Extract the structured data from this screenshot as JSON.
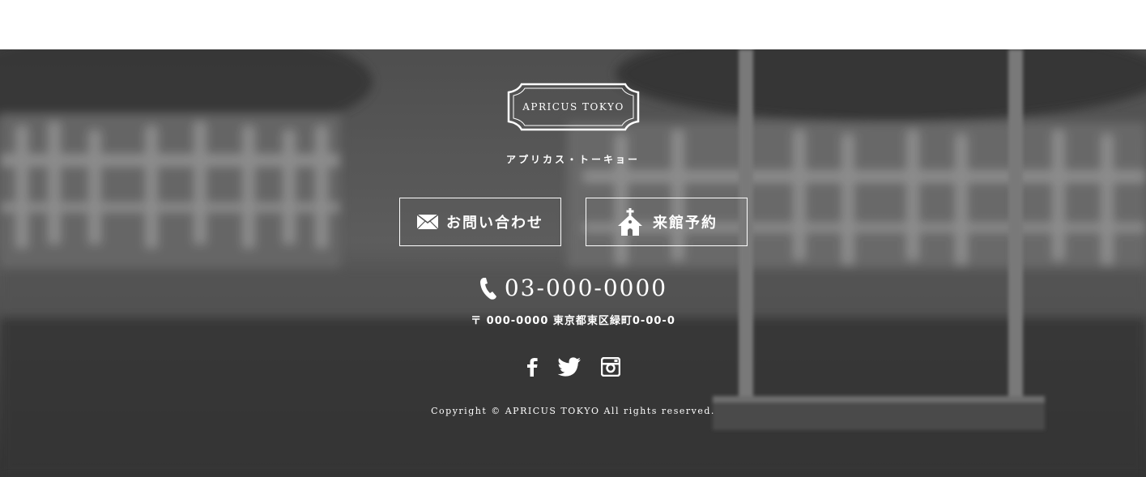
{
  "logo": {
    "text": "APRICUS TOKYO",
    "kana": "アプリカス・トーキョー"
  },
  "buttons": {
    "contact_label": "お問い合わせ",
    "visit_label": "来館予約"
  },
  "contact": {
    "phone": "03-000-0000",
    "address": "〒 000-0000 東京都東区緑町0-00-0"
  },
  "social": [
    "facebook-icon",
    "twitter-icon",
    "instagram-icon"
  ],
  "copyright": "Copyright © APRICUS TOKYO All rights reserved.",
  "colors": {
    "overlay": "#4a4a4a",
    "text": "#ffffff"
  }
}
